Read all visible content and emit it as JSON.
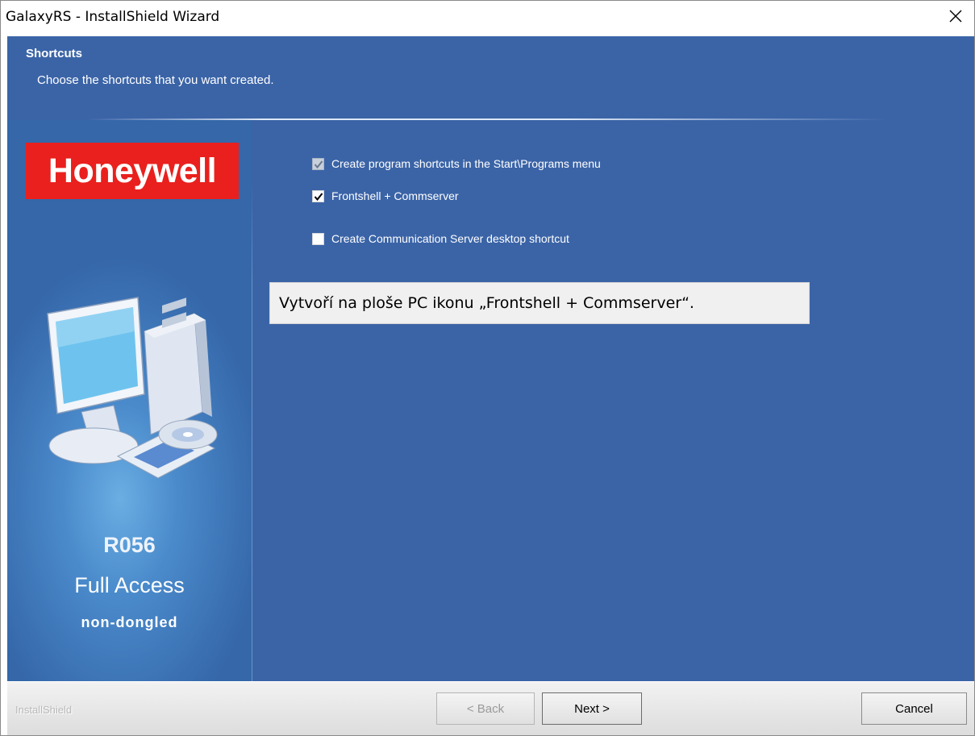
{
  "window": {
    "title": "GalaxyRS - InstallShield Wizard",
    "close_icon": "close-icon"
  },
  "header": {
    "title": "Shortcuts",
    "subtitle": "Choose the shortcuts that you want created."
  },
  "side_panel": {
    "logo_text": "Honeywell",
    "version": "R056",
    "access": "Full Access",
    "license": "non-dongled",
    "illustration_icon": "computer-with-disc-icon"
  },
  "options": [
    {
      "label": "Create program shortcuts in the Start\\Programs menu",
      "checked": true,
      "enabled": false
    },
    {
      "label": "Frontshell + Commserver",
      "checked": true,
      "enabled": true
    },
    {
      "label": "Create Communication Server desktop shortcut",
      "checked": false,
      "enabled": true
    }
  ],
  "tooltip": {
    "text": "Vytvoří na ploše PC ikonu „Frontshell + Commserver“."
  },
  "footer": {
    "brand": "InstallShield",
    "back_label": "< Back",
    "next_label": "Next >",
    "cancel_label": "Cancel"
  },
  "colors": {
    "background": "#3b64a7",
    "logo_red": "#e9201d",
    "footer": "#e4e4e4"
  }
}
